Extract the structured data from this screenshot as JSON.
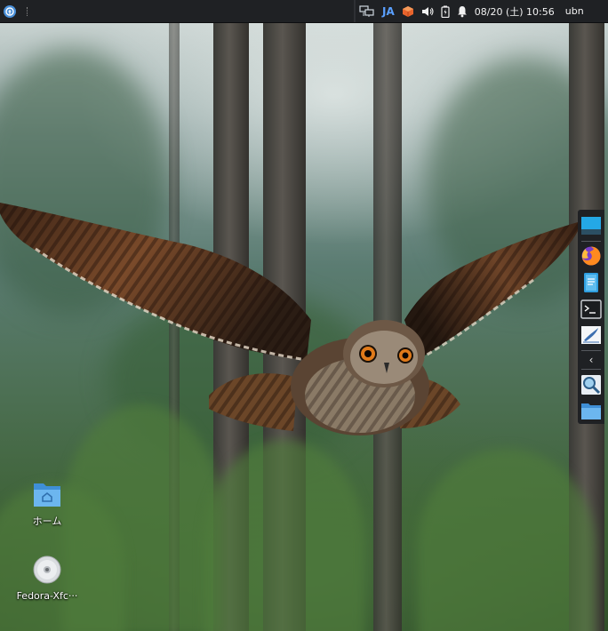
{
  "top_panel": {
    "ime": "JA",
    "clock": "08/20 (土) 10:56",
    "user": "ubn"
  },
  "desktop": {
    "icons": [
      {
        "label": "ホーム",
        "icon": "folder-home-icon"
      },
      {
        "label": "Fedora-Xfc···",
        "icon": "optical-disc-icon"
      }
    ]
  },
  "dock": {
    "items": [
      "show-desktop-icon",
      "firefox-icon",
      "file-manager-icon",
      "terminal-icon",
      "text-editor-icon",
      "collapse-arrow-icon",
      "search-app-icon",
      "folder-icon"
    ],
    "arrow": "‹"
  },
  "colors": {
    "panel_bg": "#1f2124",
    "ime_text": "#5aa0ff",
    "dock_bg": "#1f2124"
  }
}
